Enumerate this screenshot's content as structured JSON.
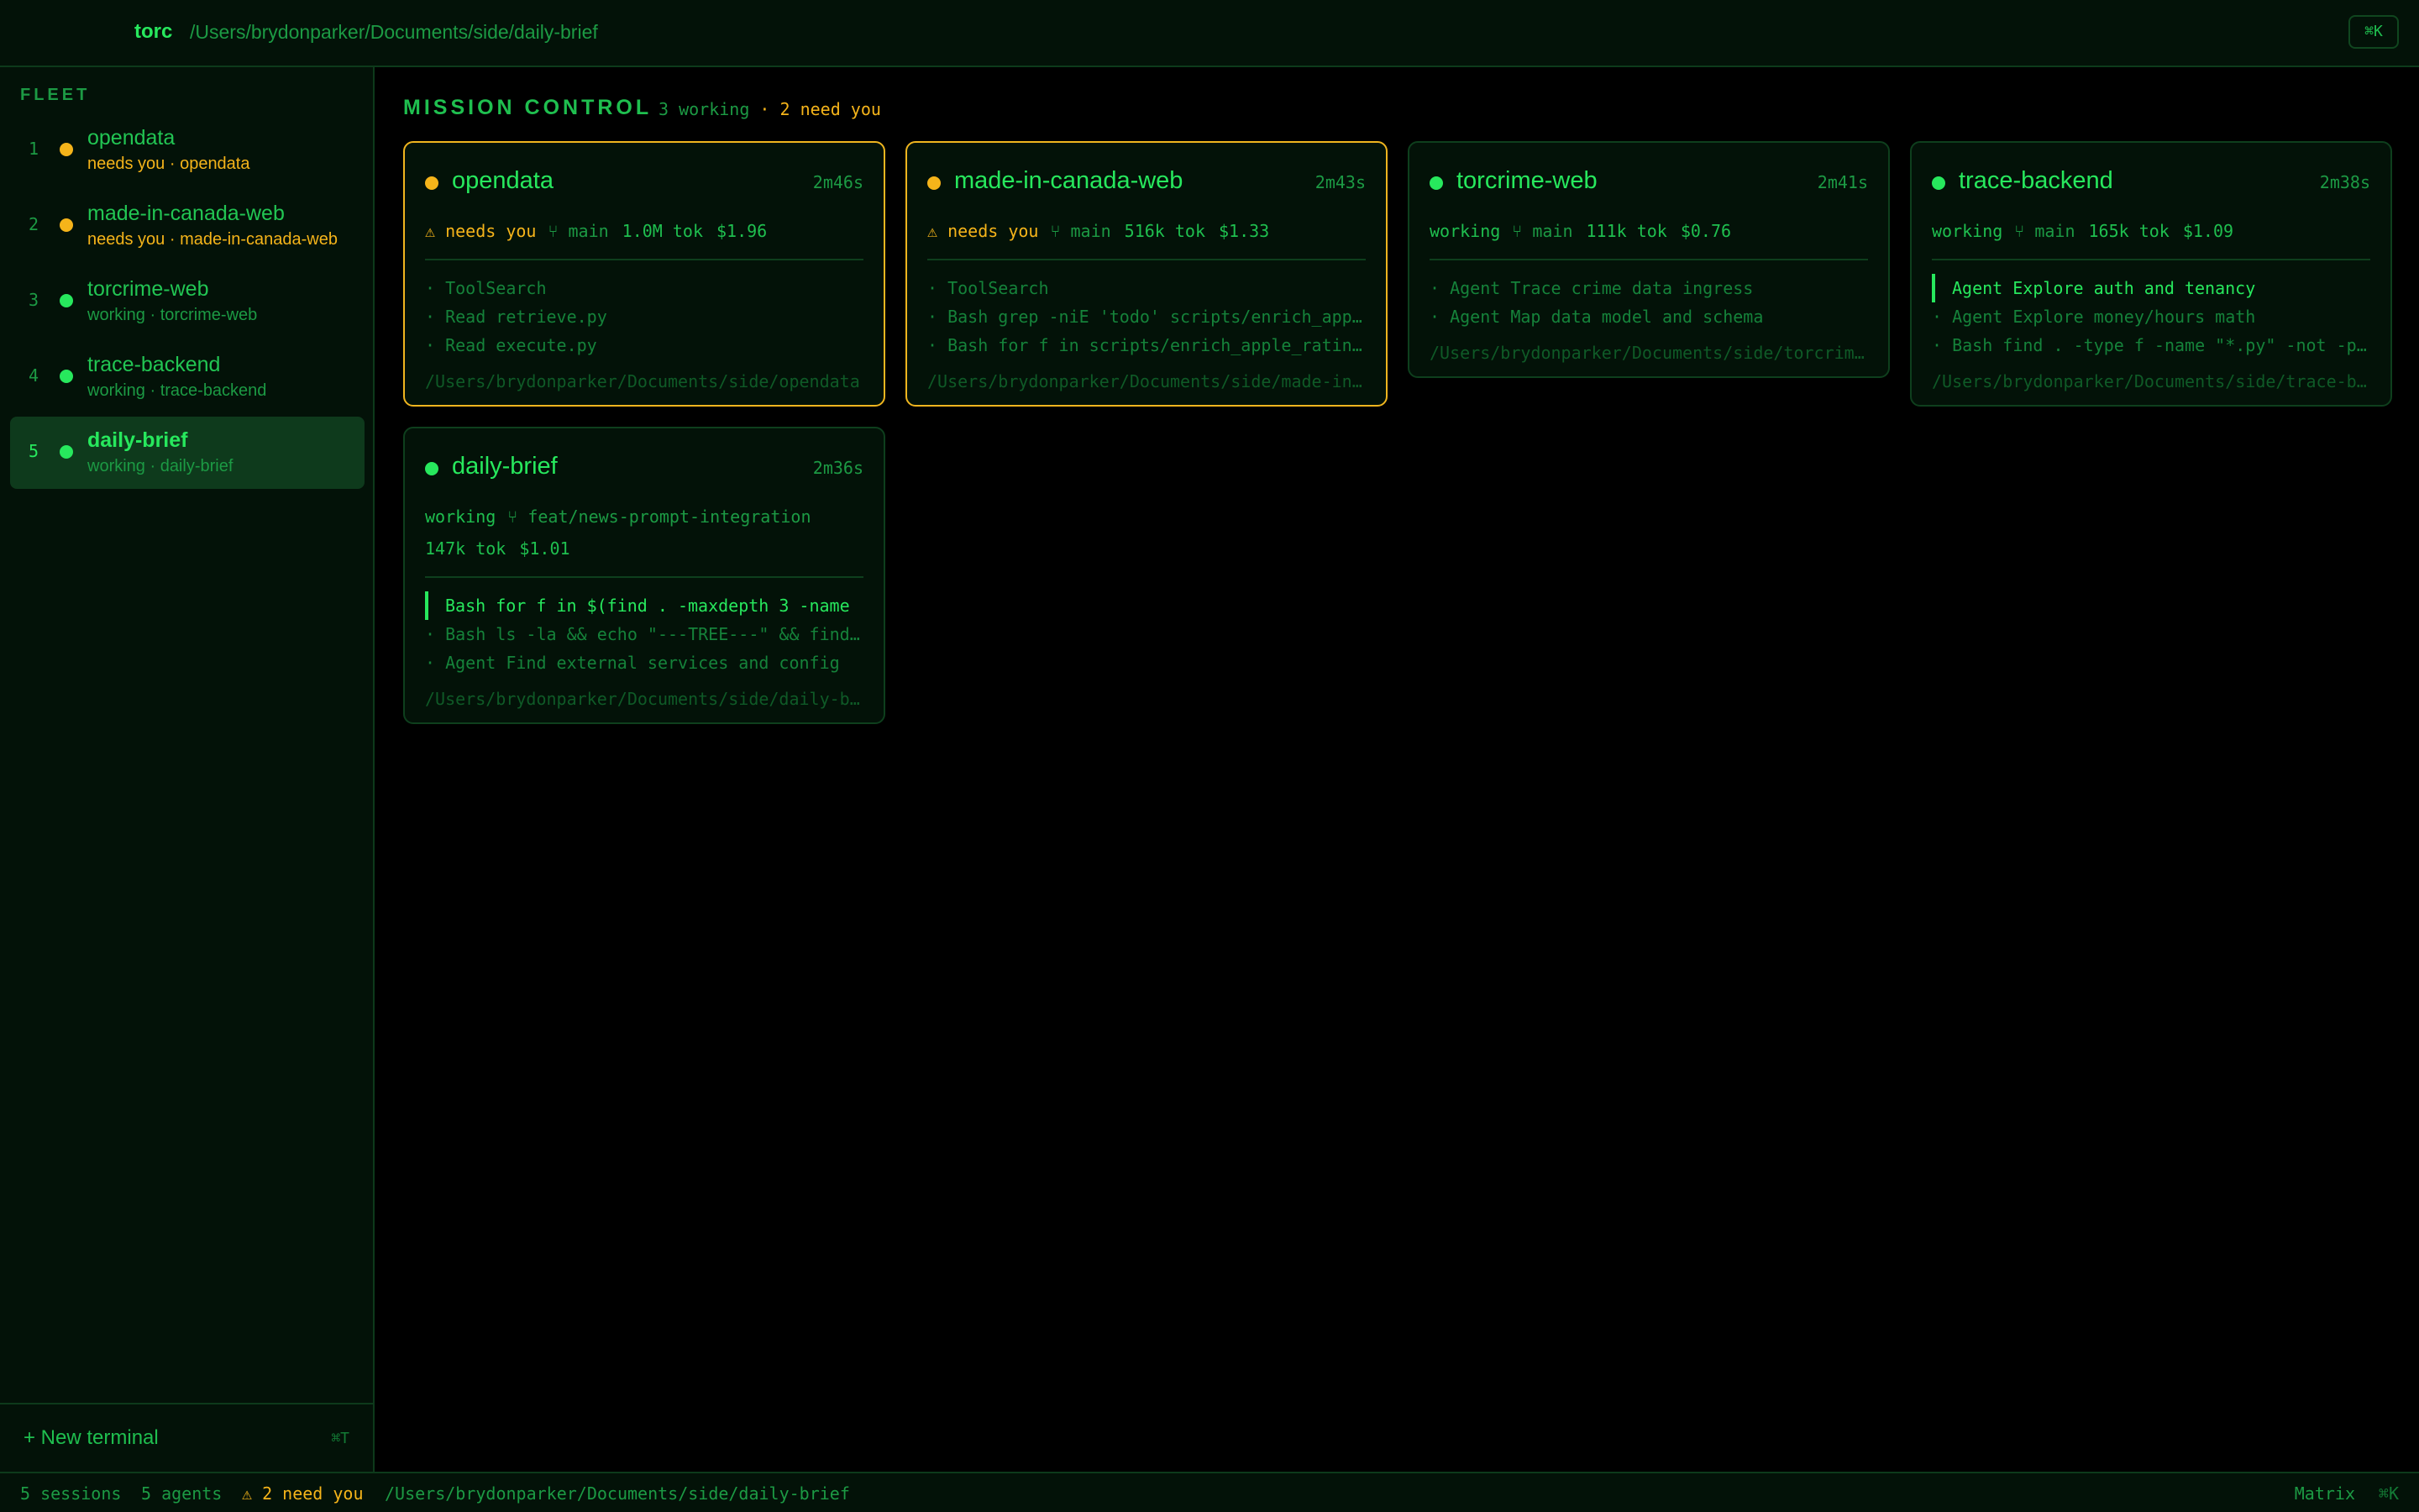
{
  "topbar": {
    "brand": "torc",
    "path": "/Users/brydonparker/Documents/side/daily-brief",
    "shortcut": "⌘K"
  },
  "colors": {
    "working": "#27e85d",
    "needs_you": "#f5b41a"
  },
  "sidebar": {
    "title": "FLEET",
    "items": [
      {
        "num": "1",
        "name": "opendata",
        "sub": "needs you · opendata",
        "status": "needs_you",
        "active": false
      },
      {
        "num": "2",
        "name": "made-in-canada-web",
        "sub": "needs you · made-in-canada-web",
        "status": "needs_you",
        "active": false
      },
      {
        "num": "3",
        "name": "torcrime-web",
        "sub": "working · torcrime-web",
        "status": "working",
        "active": false
      },
      {
        "num": "4",
        "name": "trace-backend",
        "sub": "working · trace-backend",
        "status": "working",
        "active": false
      },
      {
        "num": "5",
        "name": "daily-brief",
        "sub": "working · daily-brief",
        "status": "working",
        "active": true
      }
    ],
    "new_terminal": "+ New terminal",
    "new_terminal_shortcut": "⌘T"
  },
  "main": {
    "title": "MISSION CONTROL",
    "summary_working": "3 working",
    "summary_sep": " · ",
    "summary_need": "2 need you"
  },
  "cards": [
    {
      "name": "opendata",
      "time": "2m46s",
      "status": "needs_you",
      "state": "⚠ needs you",
      "branch": "⑂ main",
      "tokens": "1.0M tok",
      "cost": "$1.96",
      "activities": [
        {
          "text": "· ToolSearch",
          "live": false
        },
        {
          "text": "· Read retrieve.py",
          "live": false
        },
        {
          "text": "· Read execute.py",
          "live": false
        }
      ],
      "path": "/Users/brydonparker/Documents/side/opendata"
    },
    {
      "name": "made-in-canada-web",
      "time": "2m43s",
      "status": "needs_you",
      "state": "⚠ needs you",
      "branch": "⑂ main",
      "tokens": "516k tok",
      "cost": "$1.33",
      "activities": [
        {
          "text": "· ToolSearch",
          "live": false
        },
        {
          "text": "· Bash grep -niE 'todo' scripts/enrich_apple_ratings.py",
          "live": false
        },
        {
          "text": "· Bash for f in scripts/enrich_apple_ratings.py",
          "live": false
        }
      ],
      "path": "/Users/brydonparker/Documents/side/made-in-canada-web"
    },
    {
      "name": "torcrime-web",
      "time": "2m41s",
      "status": "working",
      "state": "working",
      "branch": "⑂ main",
      "tokens": "111k tok",
      "cost": "$0.76",
      "activities": [
        {
          "text": "· Agent Trace crime data ingress",
          "live": false
        },
        {
          "text": "· Agent Map data model and schema",
          "live": false
        }
      ],
      "path": "/Users/brydonparker/Documents/side/torcrime-web"
    },
    {
      "name": "trace-backend",
      "time": "2m38s",
      "status": "working",
      "state": "working",
      "branch": "⑂ main",
      "tokens": "165k tok",
      "cost": "$1.09",
      "activities": [
        {
          "text": "Agent Explore auth and tenancy",
          "live": true
        },
        {
          "text": "· Agent Explore money/hours math",
          "live": false
        },
        {
          "text": "· Bash find . -type f -name \"*.py\" -not -path",
          "live": false
        }
      ],
      "path": "/Users/brydonparker/Documents/side/trace-backend"
    },
    {
      "name": "daily-brief",
      "time": "2m36s",
      "status": "working",
      "state": "working",
      "branch": "⑂ feat/news-prompt-integration",
      "tokens": "147k tok",
      "cost": "$1.01",
      "activities": [
        {
          "text": "Bash for f in $(find . -maxdepth 3 -name",
          "live": true
        },
        {
          "text": "· Bash ls -la && echo \"---TREE---\" && find .",
          "live": false
        },
        {
          "text": "· Agent Find external services and config",
          "live": false
        }
      ],
      "path": "/Users/brydonparker/Documents/side/daily-brief"
    }
  ],
  "statusbar": {
    "sessions": "5 sessions",
    "agents": "5 agents",
    "need": "⚠ 2 need you",
    "path": "/Users/brydonparker/Documents/side/daily-brief",
    "theme": "Matrix",
    "shortcut": "⌘K"
  }
}
